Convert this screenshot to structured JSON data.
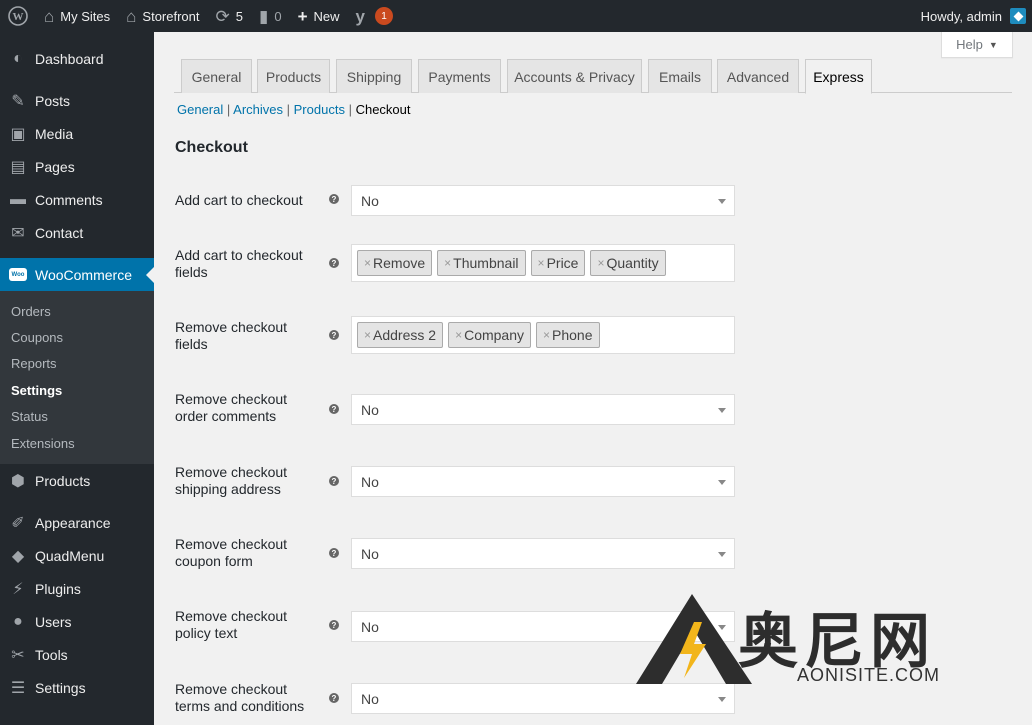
{
  "adminbar": {
    "my_sites": "My Sites",
    "site_name": "Storefront",
    "updates_count": "5",
    "comments_count": "0",
    "new_label": "New",
    "yoast_count": "1",
    "howdy": "Howdy, admin"
  },
  "sidebar": {
    "dashboard": "Dashboard",
    "posts": "Posts",
    "media": "Media",
    "pages": "Pages",
    "comments": "Comments",
    "contact": "Contact",
    "woocommerce": "WooCommerce",
    "woo_icon_text": "Woo",
    "sub": [
      "Orders",
      "Coupons",
      "Reports",
      "Settings",
      "Status",
      "Extensions"
    ],
    "products": "Products",
    "appearance": "Appearance",
    "quadmenu": "QuadMenu",
    "plugins": "Plugins",
    "users": "Users",
    "tools": "Tools",
    "settings": "Settings"
  },
  "help": {
    "label": "Help"
  },
  "tabs": [
    "General",
    "Products",
    "Shipping",
    "Payments",
    "Accounts & Privacy",
    "Emails",
    "Advanced",
    "Express"
  ],
  "active_tab": "Express",
  "subnav": {
    "general": "General",
    "archives": "Archives",
    "products": "Products",
    "checkout": "Checkout"
  },
  "section_title": "Checkout",
  "fields": {
    "add_cart_to_checkout": {
      "label": "Add cart to checkout",
      "value": "No"
    },
    "add_cart_fields": {
      "label": "Add cart to checkout fields",
      "tags": [
        "Remove",
        "Thumbnail",
        "Price",
        "Quantity"
      ]
    },
    "remove_checkout_fields": {
      "label": "Remove checkout fields",
      "tags": [
        "Address 2",
        "Company",
        "Phone"
      ]
    },
    "remove_order_comments": {
      "label": "Remove checkout order comments",
      "value": "No"
    },
    "remove_shipping_address": {
      "label": "Remove checkout shipping address",
      "value": "No"
    },
    "remove_coupon_form": {
      "label": "Remove checkout coupon form",
      "value": "No"
    },
    "remove_policy_text": {
      "label": "Remove checkout policy text",
      "value": "No"
    },
    "remove_terms": {
      "label": "Remove checkout terms and conditions",
      "value": "No"
    }
  },
  "watermark": {
    "text": "奥尼网",
    "sub": "AONISITE.COM"
  }
}
